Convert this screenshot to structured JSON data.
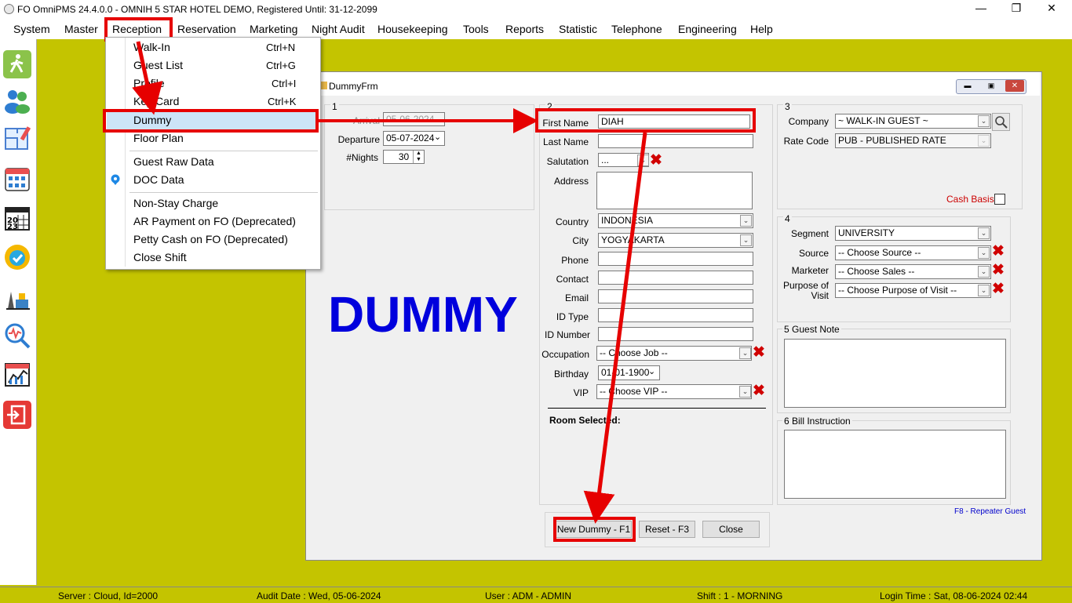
{
  "window": {
    "title": "FO OmniPMS 24.4.0.0 - OMNIH 5 STAR HOTEL DEMO, Registered Until: 31-12-2099"
  },
  "menubar": [
    "System",
    "Master",
    "Reception",
    "Reservation",
    "Marketing",
    "Night Audit",
    "Housekeeping",
    "Tools",
    "Reports",
    "Statistic",
    "Telephone",
    "Engineering",
    "Help"
  ],
  "dropdown": {
    "items": [
      {
        "label": "Walk-In",
        "shortcut": "Ctrl+N"
      },
      {
        "label": "Guest List",
        "shortcut": "Ctrl+G"
      },
      {
        "label": "Profile",
        "shortcut": "Ctrl+I"
      },
      {
        "label": "Key Card",
        "shortcut": "Ctrl+K"
      },
      {
        "label": "Dummy",
        "shortcut": ""
      },
      {
        "label": "Floor Plan",
        "shortcut": ""
      },
      {
        "label": "Guest Raw Data",
        "shortcut": ""
      },
      {
        "label": "DOC Data",
        "shortcut": ""
      },
      {
        "label": "Non-Stay Charge",
        "shortcut": ""
      },
      {
        "label": "AR Payment on FO (Deprecated)",
        "shortcut": ""
      },
      {
        "label": "Petty Cash on FO (Deprecated)",
        "shortcut": ""
      },
      {
        "label": "Close Shift",
        "shortcut": ""
      }
    ]
  },
  "form": {
    "title": "DummyFrm",
    "big_label": "DUMMY",
    "section1": {
      "num": "1",
      "arrival_label": "Arrival",
      "arrival_value": "05-06-2024",
      "departure_label": "Departure",
      "departure_value": "05-07-2024",
      "nights_label": "#Nights",
      "nights_value": "30"
    },
    "section2": {
      "num": "2",
      "first_name_label": "First Name",
      "first_name_value": "DIAH",
      "last_name_label": "Last Name",
      "last_name_value": "",
      "salutation_label": "Salutation",
      "salutation_value": "...",
      "address_label": "Address",
      "country_label": "Country",
      "country_value": "INDONESIA",
      "city_label": "City",
      "city_value": "YOGYAKARTA",
      "phone_label": "Phone",
      "contact_label": "Contact",
      "email_label": "Email",
      "id_type_label": "ID Type",
      "id_number_label": "ID Number",
      "occupation_label": "Occupation",
      "occupation_value": "-- Choose Job --",
      "birthday_label": "Birthday",
      "birthday_value": "01-01-1900",
      "vip_label": "VIP",
      "vip_value": "-- Choose VIP --",
      "room_selected_label": "Room Selected:"
    },
    "section3": {
      "num": "3",
      "company_label": "Company",
      "company_value": "~ WALK-IN GUEST ~",
      "rate_code_label": "Rate Code",
      "rate_code_value": "PUB - PUBLISHED RATE",
      "cash_basis_label": "Cash Basis"
    },
    "section4": {
      "num": "4",
      "segment_label": "Segment",
      "segment_value": "UNIVERSITY",
      "source_label": "Source",
      "source_value": "-- Choose Source --",
      "marketer_label": "Marketer",
      "marketer_value": "-- Choose Sales --",
      "purpose_label_1": "Purpose of",
      "purpose_label_2": "Visit",
      "purpose_value": "-- Choose Purpose of Visit --"
    },
    "guest_note_label": "5 Guest Note",
    "bill_instruction_label": "6 Bill Instruction",
    "repeater_link": "F8 - Repeater Guest",
    "buttons": {
      "new_dummy": "New Dummy - F1",
      "reset": "Reset - F3",
      "close": "Close"
    }
  },
  "statusbar": {
    "server": "Server : Cloud, Id=2000",
    "audit_date": "Audit Date : Wed, 05-06-2024",
    "user": "User : ADM - ADMIN",
    "shift": "Shift : 1 - MORNING",
    "login_time": "Login Time : Sat, 08-06-2024 02:44"
  },
  "colors": {
    "background": "#c4c400",
    "highlight": "#e60000",
    "dummy_text": "#0000dd"
  }
}
